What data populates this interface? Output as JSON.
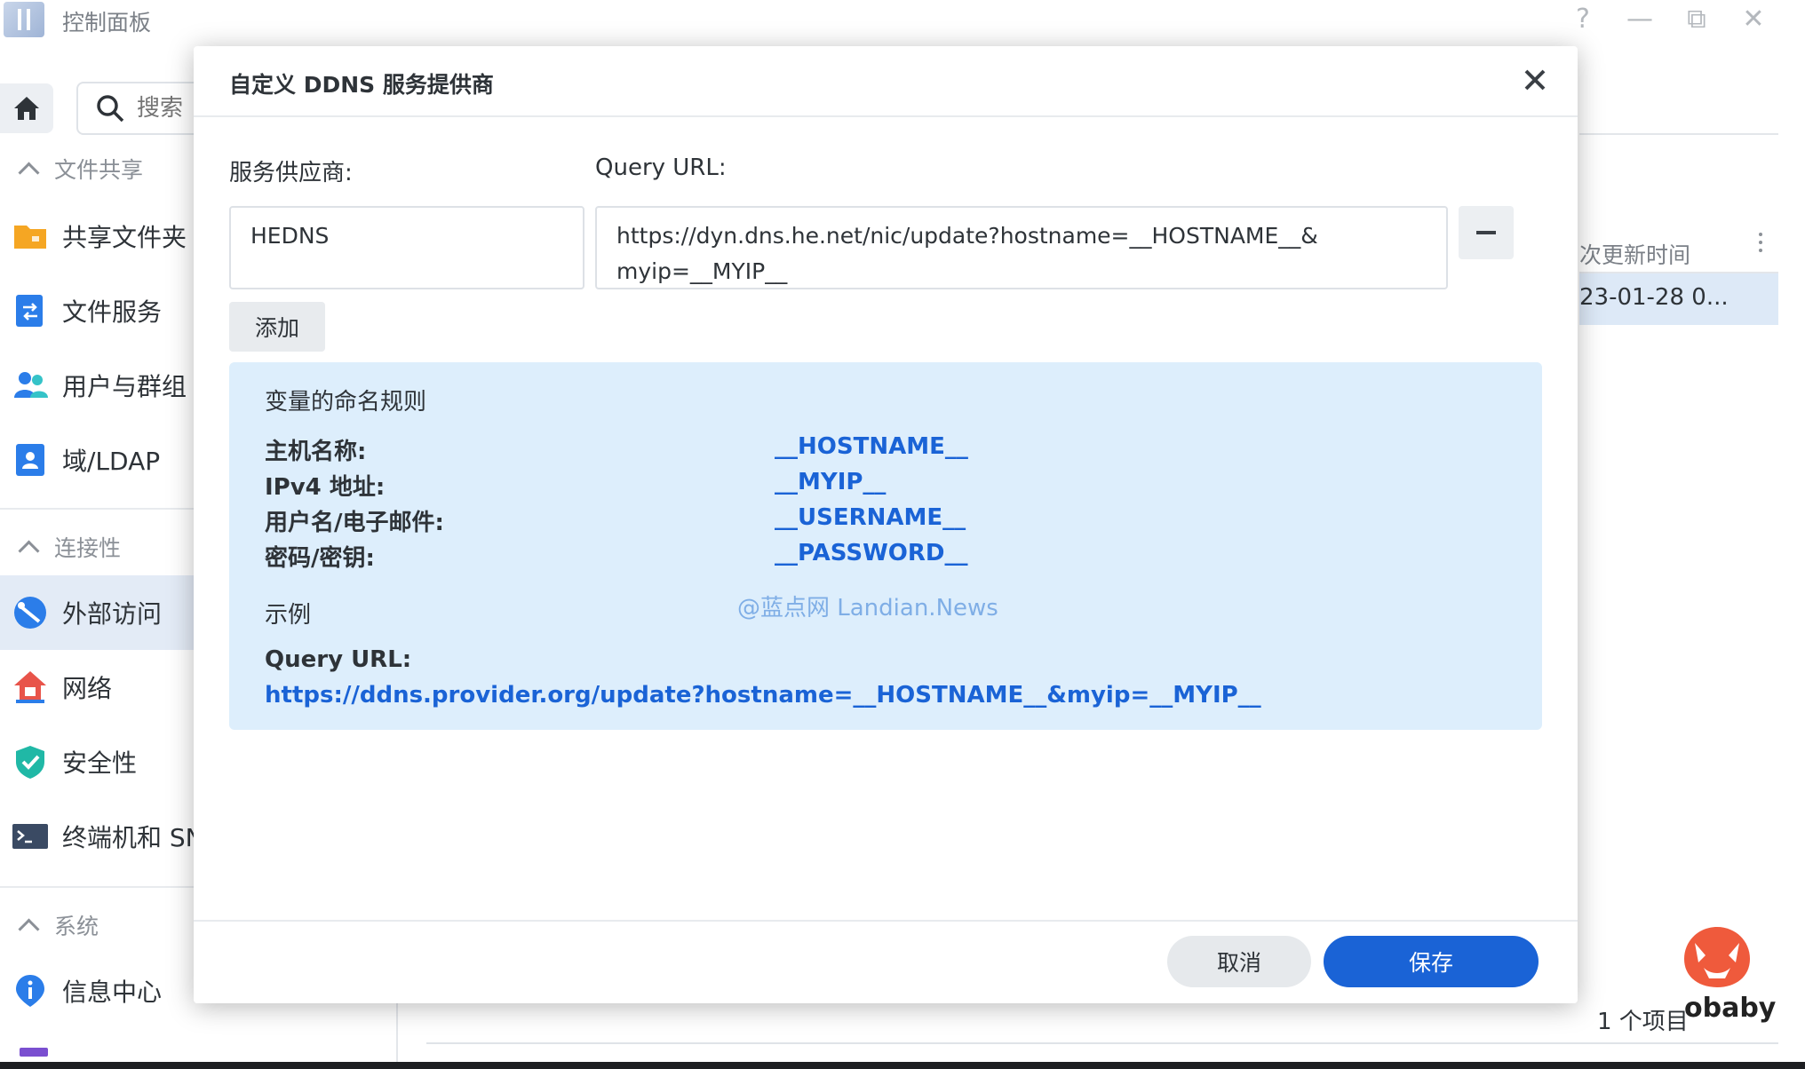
{
  "window": {
    "title": "控制面板",
    "help_glyph": "?",
    "minimize_glyph": "—",
    "restore_glyph": "⧉",
    "close_glyph": "✕"
  },
  "sidebar": {
    "search_placeholder": "搜索",
    "sections": [
      {
        "label": "文件共享"
      },
      {
        "label": "连接性"
      },
      {
        "label": "系统"
      }
    ],
    "items": [
      {
        "label": "共享文件夹",
        "icon": "folder-icon"
      },
      {
        "label": "文件服务",
        "icon": "file-services-icon"
      },
      {
        "label": "用户与群组",
        "icon": "users-icon"
      },
      {
        "label": "域/LDAP",
        "icon": "domain-icon"
      },
      {
        "label": "外部访问",
        "icon": "external-access-icon",
        "active": true
      },
      {
        "label": "网络",
        "icon": "network-icon"
      },
      {
        "label": "安全性",
        "icon": "shield-icon"
      },
      {
        "label": "终端机和 SNMP",
        "icon": "terminal-icon"
      },
      {
        "label": "信息中心",
        "icon": "info-icon"
      }
    ]
  },
  "background_table": {
    "column_header": "次更新时间",
    "row_value": "23-01-28 0...",
    "footer_count": "1 个项目"
  },
  "dialog": {
    "title": "自定义 DDNS 服务提供商",
    "provider_label": "服务供应商:",
    "query_url_label": "Query URL:",
    "provider_value": "HEDNS",
    "query_url_value_line1": "https://dyn.dns.he.net/nic/update?hostname=__HOSTNAME__&",
    "query_url_value_line2": "myip=__MYIP__",
    "add_label": "添加",
    "info": {
      "title": "变量的命名规则",
      "variables": [
        {
          "label": "主机名称:",
          "value": "__HOSTNAME__"
        },
        {
          "label": "IPv4 地址:",
          "value": "__MYIP__"
        },
        {
          "label": "用户名/电子邮件:",
          "value": "__USERNAME__"
        },
        {
          "label": "密码/密钥:",
          "value": "__PASSWORD__"
        }
      ],
      "example_label": "示例",
      "watermark": "@蓝点网 Landian.News",
      "example_query_label": "Query URL:",
      "example_query_url": "https://ddns.provider.org/update?hostname=__HOSTNAME__&myip=__MYIP__"
    },
    "cancel_label": "取消",
    "save_label": "保存"
  },
  "brand": {
    "text": "obaby"
  },
  "colors": {
    "accent": "#1a63d6",
    "info_bg": "#ddeefc",
    "active_item_bg": "#e3ebf6"
  }
}
